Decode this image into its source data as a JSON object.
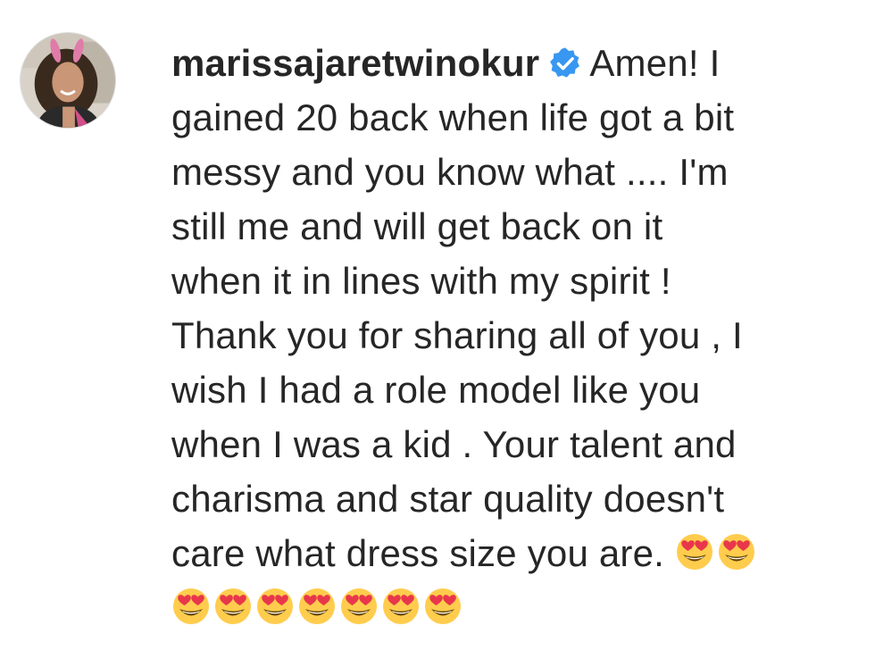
{
  "comment": {
    "username": "marissajaretwinokur",
    "verified_icon": "verified-badge-icon",
    "avatar_icon": "profile-avatar",
    "lines": [
      "Amen! I",
      "gained 20 back when life got a bit",
      "messy and you know what .... I'm",
      "still me and will get back on it",
      "when it in lines with my spirit !",
      "Thank you for sharing all of you , I",
      "wish I had a role model like you",
      "when I was a kid . Your talent and",
      "charisma and star quality doesn't",
      "care what dress size you are."
    ],
    "emoji_name": "heart-eyes-emoji",
    "emoji_count_line10": 2,
    "emoji_count_line11": 7
  },
  "colors": {
    "text": "#262626",
    "verified_badge": "#3897f0",
    "emoji_face": "#ffcc4d",
    "emoji_heart": "#e8374b"
  }
}
